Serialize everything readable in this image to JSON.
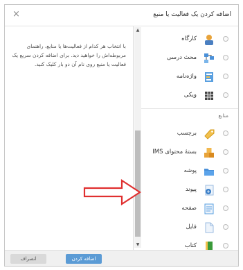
{
  "dialog": {
    "title": "اضافه کردن یک فعالیت یا منبع",
    "close_label": "×"
  },
  "help_text": "با انتخاب هر کدام از فعالیت‌ها یا منابع، راهنمای مربوطه‌اش را خواهید دید. برای اضافه کردن سریع یک فعالیت یا منبع روی نام آن دو بار کلیک کنید.",
  "activities": [
    {
      "label": "کارگاه",
      "icon": "workshop-icon"
    },
    {
      "label": "محث درسی",
      "icon": "lesson-icon"
    },
    {
      "label": "واژه‌نامه",
      "icon": "glossary-icon"
    },
    {
      "label": "ویکی",
      "icon": "wiki-icon"
    }
  ],
  "resources_title": "منابع",
  "resources": [
    {
      "label": "برچسب",
      "icon": "label-tag-icon"
    },
    {
      "label": "بستهٔ محتوای IMS",
      "icon": "ims-package-icon"
    },
    {
      "label": "پوشه",
      "icon": "folder-icon"
    },
    {
      "label": "پیوند",
      "icon": "url-link-icon"
    },
    {
      "label": "صفحه",
      "icon": "page-icon"
    },
    {
      "label": "فایل",
      "icon": "file-icon"
    },
    {
      "label": "کتاب",
      "icon": "book-icon"
    }
  ],
  "buttons": {
    "add": "اضافه کردن",
    "cancel": "انصراف"
  },
  "colors": {
    "primary": "#5b9bd5",
    "arrow": "#e03030"
  }
}
